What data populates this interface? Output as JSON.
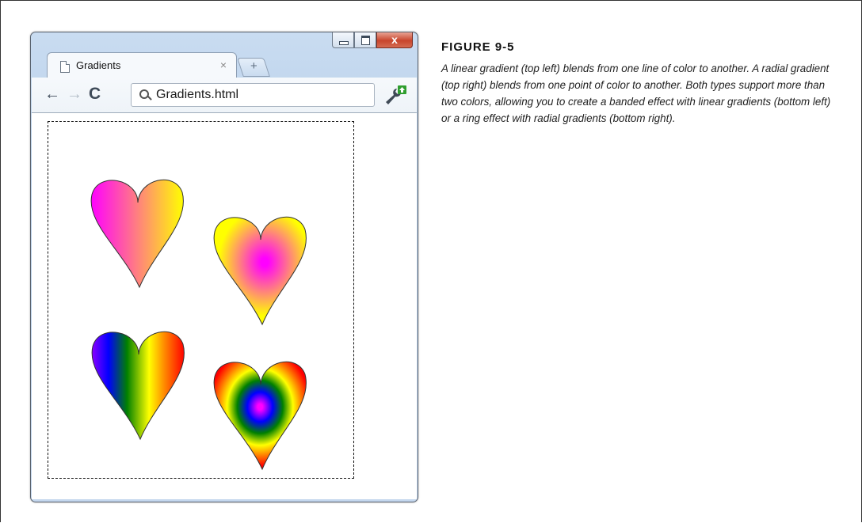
{
  "figure": {
    "title": "FIGURE 9-5",
    "caption": "A linear gradient (top left) blends from one line of color to another. A radial gradient (top right) blends from one point of color to another. Both types support more than two colors, allowing you to create a banded effect with linear gradients (bottom left) or a ring effect with radial gradients (bottom right)."
  },
  "browser": {
    "tab_title": "Gradients",
    "tab_close": "×",
    "new_tab": "+",
    "address": "Gradients.html",
    "window_close": "x",
    "icons": [
      "page-icon",
      "back-arrow-icon",
      "forward-arrow-icon",
      "reload-icon",
      "search-icon",
      "wrench-icon"
    ]
  },
  "hearts": [
    {
      "label": "linear-two-color",
      "colors": [
        "#ff00ff",
        "#ffff00"
      ]
    },
    {
      "label": "radial-two-color",
      "colors": [
        "#ff00ff",
        "#ffff00"
      ]
    },
    {
      "label": "linear-banded",
      "colors": [
        "#8a00ff",
        "#0000ff",
        "#008000",
        "#ffff00",
        "#ff8000",
        "#ff0000"
      ]
    },
    {
      "label": "radial-rings",
      "colors": [
        "#ff00ff",
        "#0000ff",
        "#008000",
        "#ffff00",
        "#ff8000",
        "#ff0000"
      ]
    }
  ]
}
